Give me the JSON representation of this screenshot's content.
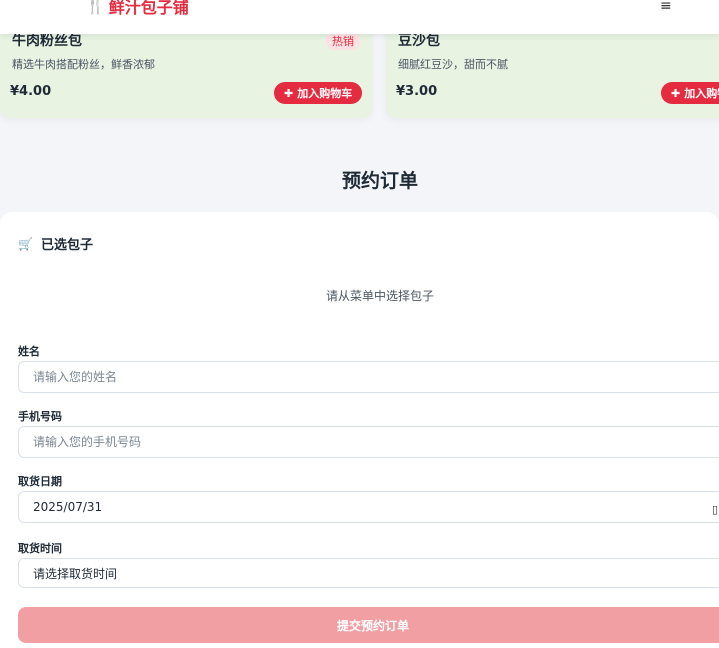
{
  "header": {
    "brand": "鲜汁包子铺",
    "brand_icon": "utensils-icon",
    "menu_icon": "≡"
  },
  "products": [
    {
      "name": "牛肉粉丝包",
      "badge": "热销",
      "desc": "精选牛肉搭配粉丝，鲜香浓郁",
      "price": "¥4.00",
      "add_label": "加入购物车"
    },
    {
      "name": "豆沙包",
      "desc": "细腻红豆沙，甜而不腻",
      "price": "¥3.00",
      "add_label": "加入购物车"
    }
  ],
  "order": {
    "title": "预约订单",
    "selected_title": "已选包子",
    "empty_text": "请从菜单中选择包子",
    "name_label": "姓名",
    "name_placeholder": "请输入您的姓名",
    "phone_label": "手机号码",
    "phone_placeholder": "请输入您的手机号码",
    "date_label": "取货日期",
    "date_value": "2025/07/31",
    "time_label": "取货时间",
    "time_value": "请选择取货时间",
    "submit_label": "提交预约订单"
  },
  "colors": {
    "accent": "#e52b40",
    "card_bg": "#e8f3e2",
    "submit_disabled": "#f19fa3"
  }
}
